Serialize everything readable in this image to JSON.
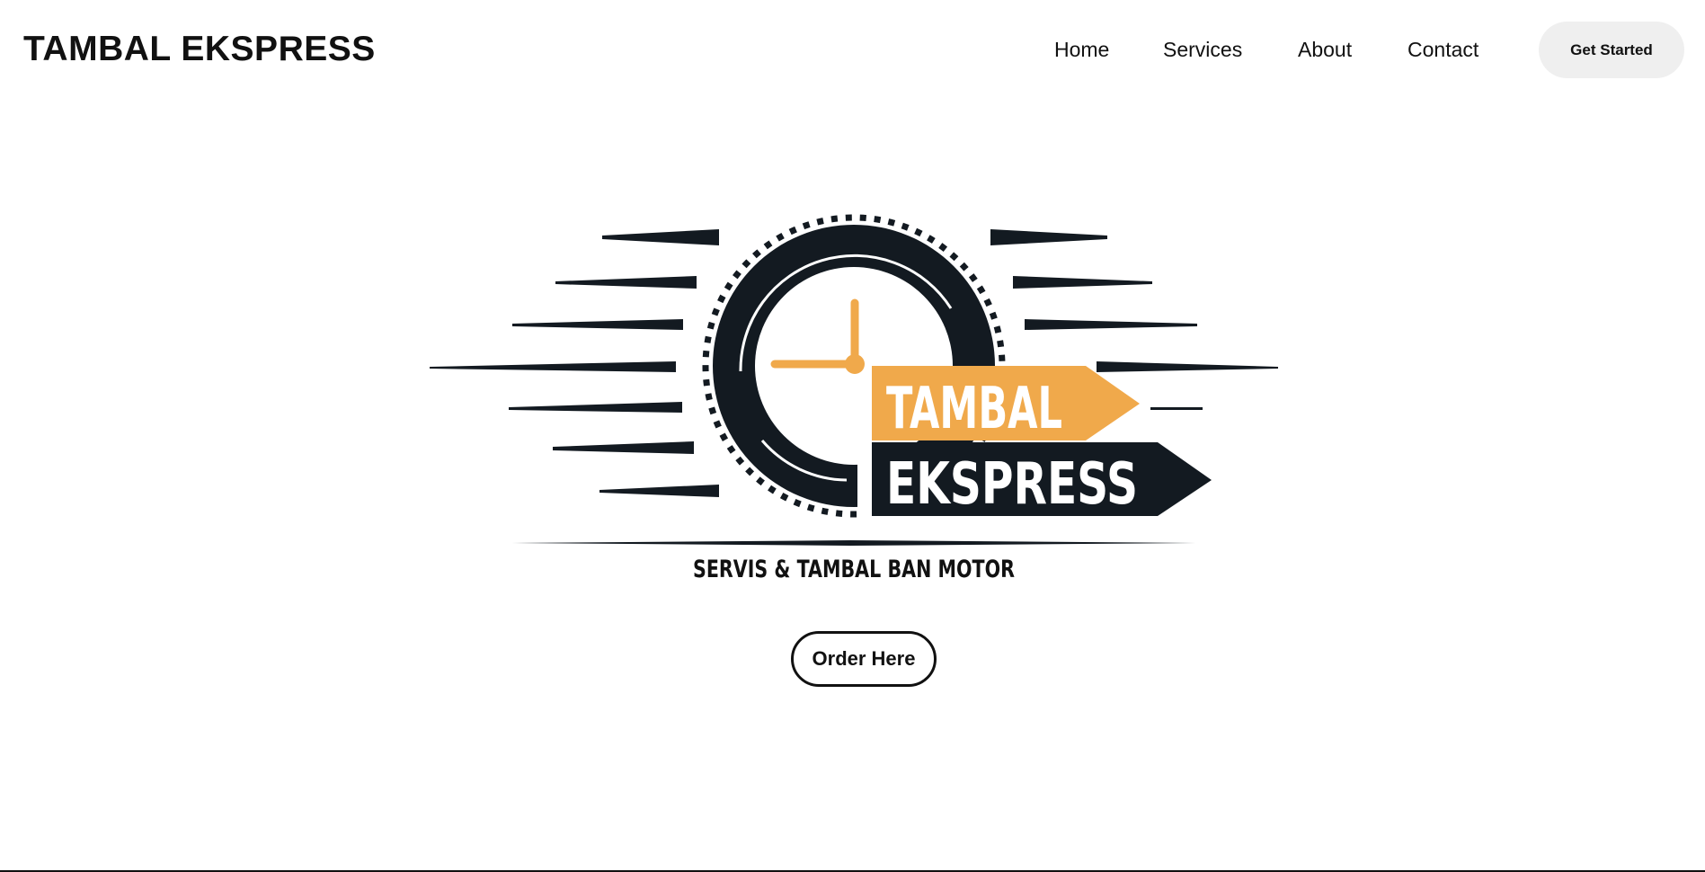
{
  "header": {
    "brand": "TAMBAL EKSPRESS",
    "nav": [
      {
        "label": "Home"
      },
      {
        "label": "Services"
      },
      {
        "label": "About"
      },
      {
        "label": "Contact"
      }
    ],
    "cta_label": "Get Started"
  },
  "hero": {
    "logo": {
      "word_top": "TAMBAL",
      "word_bottom": "EKSPRESS",
      "tagline": "SERVIS & TAMBAL BAN MOTOR",
      "icons": [
        "tire-icon",
        "clock-hands-icon",
        "speed-lines-icon"
      ],
      "colors": {
        "dark": "#131a21",
        "accent": "#f0a94b",
        "white": "#ffffff"
      }
    },
    "order_label": "Order Here"
  }
}
